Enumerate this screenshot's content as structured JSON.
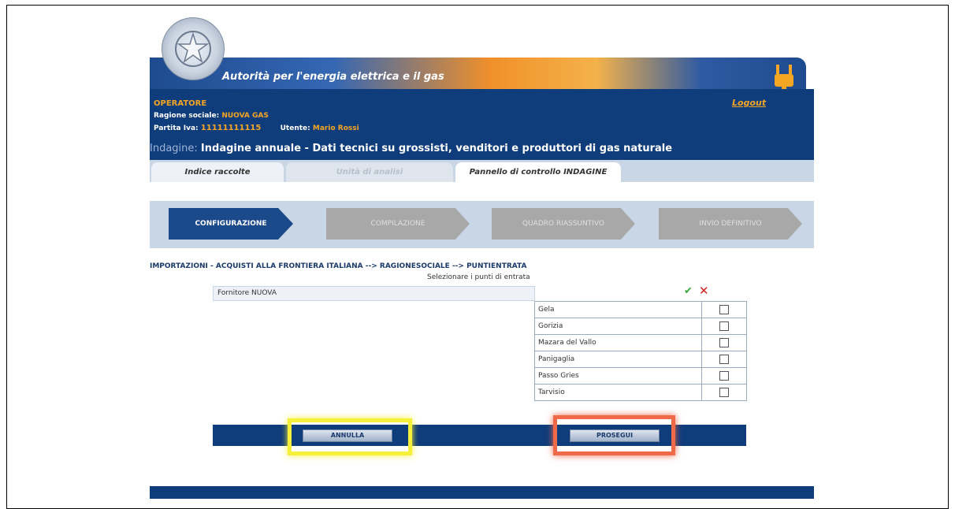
{
  "header": {
    "agency": "Autorità per l'energia elettrica e il gas",
    "logout": "Logout"
  },
  "operator": {
    "label": "OPERATORE",
    "ragione_label": "Ragione sociale:",
    "ragione_value": "NUOVA GAS",
    "piva_label": "Partita Iva:",
    "piva_value": "11111111115",
    "utente_label": "Utente:",
    "utente_value": "Mario Rossi",
    "indagine_label": "Indagine:",
    "indagine_value": "Indagine annuale - Dati tecnici su grossisti, venditori e produttori di gas naturale"
  },
  "tabs": [
    {
      "label": "Indice raccolte"
    },
    {
      "label": "Unità di analisi"
    },
    {
      "label": "Pannello di controllo INDAGINE"
    }
  ],
  "steps": [
    {
      "label": "CONFIGURAZIONE"
    },
    {
      "label": "COMPILAZIONE"
    },
    {
      "label": "QUADRO RIASSUNTIVO"
    },
    {
      "label": "INVIO DEFINITIVO"
    }
  ],
  "breadcrumb": "IMPORTAZIONI - ACQUISTI ALLA FRONTIERA ITALIANA --> RAGIONESOCIALE --> PUNTIENTRATA",
  "selection_hint": "Selezionare i punti di entrata",
  "fornitore": "Fornitore NUOVA",
  "points": [
    {
      "name": "Gela"
    },
    {
      "name": "Gorizia"
    },
    {
      "name": "Mazara del Vallo"
    },
    {
      "name": "Panigaglia"
    },
    {
      "name": "Passo Gries"
    },
    {
      "name": "Tarvisio"
    }
  ],
  "actions": {
    "cancel": "ANNULLA",
    "proceed": "PROSEGUI"
  }
}
